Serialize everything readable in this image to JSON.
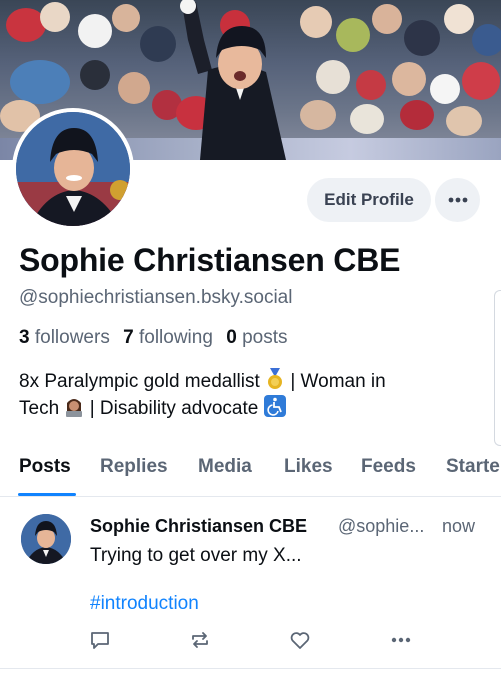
{
  "profile": {
    "display_name": "Sophie Christiansen CBE",
    "handle": "@sophiechristiansen.bsky.social",
    "followers_count": "3",
    "followers_label": "followers",
    "following_count": "7",
    "following_label": "following",
    "posts_count": "0",
    "posts_label": "posts",
    "bio_line1_text": "8x Paralympic gold medallist ",
    "bio_line1_after": " | Woman in",
    "bio_line2_text": "Tech ",
    "bio_line2_after": " | Disability advocate ",
    "icons": [
      "medal-icon",
      "woman-technologist-icon",
      "wheelchair-symbol-icon"
    ]
  },
  "header": {
    "edit_profile_label": "Edit Profile",
    "more_icon": "ellipsis-icon"
  },
  "tabs": [
    {
      "label": "Posts",
      "active": true
    },
    {
      "label": "Replies",
      "active": false
    },
    {
      "label": "Media",
      "active": false
    },
    {
      "label": "Likes",
      "active": false
    },
    {
      "label": "Feeds",
      "active": false
    },
    {
      "label": "Starte",
      "active": false
    }
  ],
  "post": {
    "author": "Sophie Christiansen CBE",
    "handle": "@sophie...",
    "time": "now",
    "text": "Trying to get over my X...",
    "hashtag": "#introduction",
    "actions": [
      "reply-icon",
      "repost-icon",
      "like-icon",
      "more-icon"
    ]
  },
  "colors": {
    "accent": "#1083fe",
    "muted_text": "#5b6675",
    "button_bg": "#eef1f5"
  }
}
